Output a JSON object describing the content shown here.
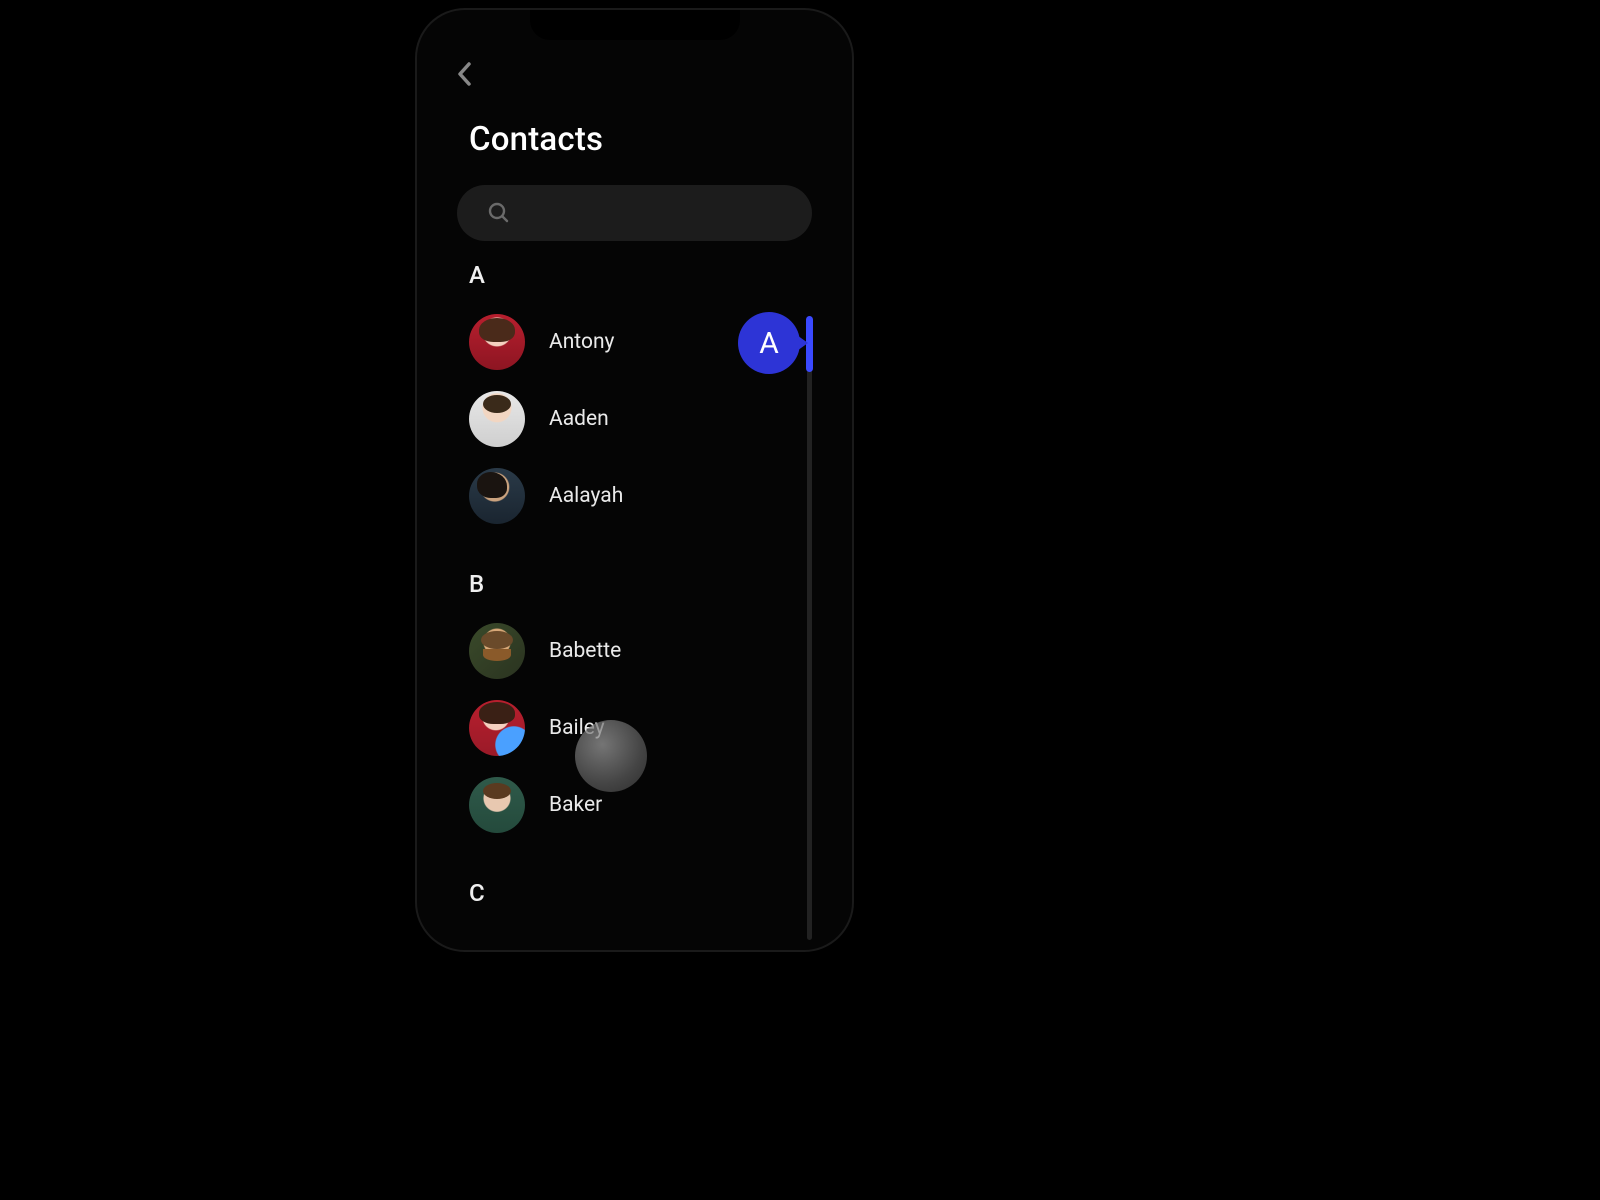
{
  "header": {
    "title": "Contacts"
  },
  "search": {
    "placeholder": ""
  },
  "index": {
    "current_letter": "A"
  },
  "sections": [
    {
      "letter": "A",
      "contacts": [
        {
          "name": "Antony",
          "avatar": "av-1"
        },
        {
          "name": "Aaden",
          "avatar": "av-2"
        },
        {
          "name": "Aalayah",
          "avatar": "av-3"
        }
      ]
    },
    {
      "letter": "B",
      "contacts": [
        {
          "name": "Babette",
          "avatar": "av-4"
        },
        {
          "name": "Bailey",
          "avatar": "av-5"
        },
        {
          "name": "Baker",
          "avatar": "av-6"
        }
      ]
    },
    {
      "letter": "C",
      "contacts": []
    }
  ]
}
